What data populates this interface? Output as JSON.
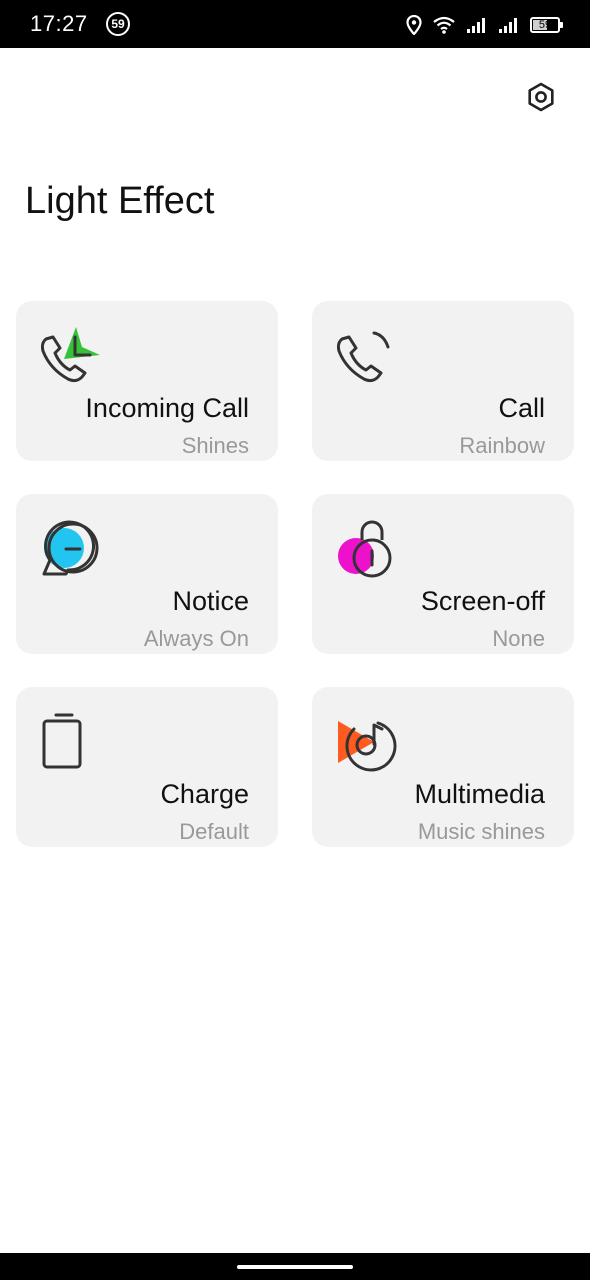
{
  "status_bar": {
    "time": "17:27",
    "notification_count": "59",
    "battery_level": "59",
    "battery_fraction": 0.59,
    "icons": [
      "location-icon",
      "wifi-icon",
      "signal-icon",
      "signal-icon",
      "battery-icon"
    ]
  },
  "header": {
    "title": "Light Effect",
    "settings_icon": "settings-icon"
  },
  "cards": [
    {
      "title": "Incoming Call",
      "subtitle": "Shines",
      "icon": "incoming-call-icon",
      "accent": "#2ecc40"
    },
    {
      "title": "Call",
      "subtitle": "Rainbow",
      "icon": "call-icon",
      "accent": "#333333"
    },
    {
      "title": "Notice",
      "subtitle": "Always On",
      "icon": "notice-icon",
      "accent": "#22c4f0"
    },
    {
      "title": "Screen-off",
      "subtitle": "None",
      "icon": "lock-icon",
      "accent": "#ee11cc"
    },
    {
      "title": "Charge",
      "subtitle": "Default",
      "icon": "battery-icon",
      "accent": "#333333"
    },
    {
      "title": "Multimedia",
      "subtitle": "Music shines",
      "icon": "music-icon",
      "accent": "#ff5a1f"
    }
  ],
  "colors": {
    "card_background": "#f2f2f2",
    "title_text": "#111111",
    "subtitle_text": "#999999",
    "icon_stroke": "#333333"
  }
}
